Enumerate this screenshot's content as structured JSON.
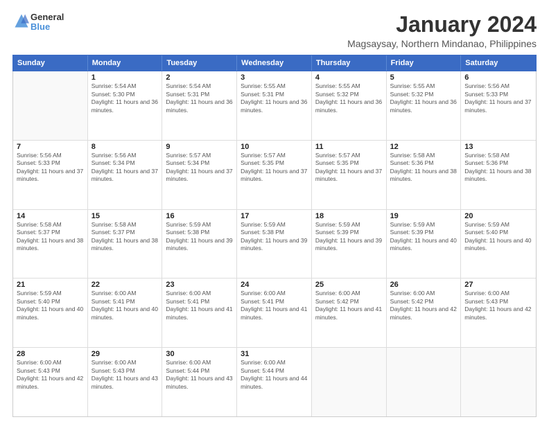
{
  "header": {
    "logo_line1": "General",
    "logo_line2": "Blue",
    "title": "January 2024",
    "subtitle": "Magsaysay, Northern Mindanao, Philippines"
  },
  "days_of_week": [
    "Sunday",
    "Monday",
    "Tuesday",
    "Wednesday",
    "Thursday",
    "Friday",
    "Saturday"
  ],
  "weeks": [
    [
      {
        "day": "",
        "empty": true
      },
      {
        "day": "1",
        "sunrise": "5:54 AM",
        "sunset": "5:30 PM",
        "daylight": "11 hours and 36 minutes."
      },
      {
        "day": "2",
        "sunrise": "5:54 AM",
        "sunset": "5:31 PM",
        "daylight": "11 hours and 36 minutes."
      },
      {
        "day": "3",
        "sunrise": "5:55 AM",
        "sunset": "5:31 PM",
        "daylight": "11 hours and 36 minutes."
      },
      {
        "day": "4",
        "sunrise": "5:55 AM",
        "sunset": "5:32 PM",
        "daylight": "11 hours and 36 minutes."
      },
      {
        "day": "5",
        "sunrise": "5:55 AM",
        "sunset": "5:32 PM",
        "daylight": "11 hours and 36 minutes."
      },
      {
        "day": "6",
        "sunrise": "5:56 AM",
        "sunset": "5:33 PM",
        "daylight": "11 hours and 37 minutes."
      }
    ],
    [
      {
        "day": "7",
        "sunrise": "5:56 AM",
        "sunset": "5:33 PM",
        "daylight": "11 hours and 37 minutes."
      },
      {
        "day": "8",
        "sunrise": "5:56 AM",
        "sunset": "5:34 PM",
        "daylight": "11 hours and 37 minutes."
      },
      {
        "day": "9",
        "sunrise": "5:57 AM",
        "sunset": "5:34 PM",
        "daylight": "11 hours and 37 minutes."
      },
      {
        "day": "10",
        "sunrise": "5:57 AM",
        "sunset": "5:35 PM",
        "daylight": "11 hours and 37 minutes."
      },
      {
        "day": "11",
        "sunrise": "5:57 AM",
        "sunset": "5:35 PM",
        "daylight": "11 hours and 37 minutes."
      },
      {
        "day": "12",
        "sunrise": "5:58 AM",
        "sunset": "5:36 PM",
        "daylight": "11 hours and 38 minutes."
      },
      {
        "day": "13",
        "sunrise": "5:58 AM",
        "sunset": "5:36 PM",
        "daylight": "11 hours and 38 minutes."
      }
    ],
    [
      {
        "day": "14",
        "sunrise": "5:58 AM",
        "sunset": "5:37 PM",
        "daylight": "11 hours and 38 minutes."
      },
      {
        "day": "15",
        "sunrise": "5:58 AM",
        "sunset": "5:37 PM",
        "daylight": "11 hours and 38 minutes."
      },
      {
        "day": "16",
        "sunrise": "5:59 AM",
        "sunset": "5:38 PM",
        "daylight": "11 hours and 39 minutes."
      },
      {
        "day": "17",
        "sunrise": "5:59 AM",
        "sunset": "5:38 PM",
        "daylight": "11 hours and 39 minutes."
      },
      {
        "day": "18",
        "sunrise": "5:59 AM",
        "sunset": "5:39 PM",
        "daylight": "11 hours and 39 minutes."
      },
      {
        "day": "19",
        "sunrise": "5:59 AM",
        "sunset": "5:39 PM",
        "daylight": "11 hours and 40 minutes."
      },
      {
        "day": "20",
        "sunrise": "5:59 AM",
        "sunset": "5:40 PM",
        "daylight": "11 hours and 40 minutes."
      }
    ],
    [
      {
        "day": "21",
        "sunrise": "5:59 AM",
        "sunset": "5:40 PM",
        "daylight": "11 hours and 40 minutes."
      },
      {
        "day": "22",
        "sunrise": "6:00 AM",
        "sunset": "5:41 PM",
        "daylight": "11 hours and 40 minutes."
      },
      {
        "day": "23",
        "sunrise": "6:00 AM",
        "sunset": "5:41 PM",
        "daylight": "11 hours and 41 minutes."
      },
      {
        "day": "24",
        "sunrise": "6:00 AM",
        "sunset": "5:41 PM",
        "daylight": "11 hours and 41 minutes."
      },
      {
        "day": "25",
        "sunrise": "6:00 AM",
        "sunset": "5:42 PM",
        "daylight": "11 hours and 41 minutes."
      },
      {
        "day": "26",
        "sunrise": "6:00 AM",
        "sunset": "5:42 PM",
        "daylight": "11 hours and 42 minutes."
      },
      {
        "day": "27",
        "sunrise": "6:00 AM",
        "sunset": "5:43 PM",
        "daylight": "11 hours and 42 minutes."
      }
    ],
    [
      {
        "day": "28",
        "sunrise": "6:00 AM",
        "sunset": "5:43 PM",
        "daylight": "11 hours and 42 minutes."
      },
      {
        "day": "29",
        "sunrise": "6:00 AM",
        "sunset": "5:43 PM",
        "daylight": "11 hours and 43 minutes."
      },
      {
        "day": "30",
        "sunrise": "6:00 AM",
        "sunset": "5:44 PM",
        "daylight": "11 hours and 43 minutes."
      },
      {
        "day": "31",
        "sunrise": "6:00 AM",
        "sunset": "5:44 PM",
        "daylight": "11 hours and 44 minutes."
      },
      {
        "day": "",
        "empty": true
      },
      {
        "day": "",
        "empty": true
      },
      {
        "day": "",
        "empty": true
      }
    ]
  ]
}
